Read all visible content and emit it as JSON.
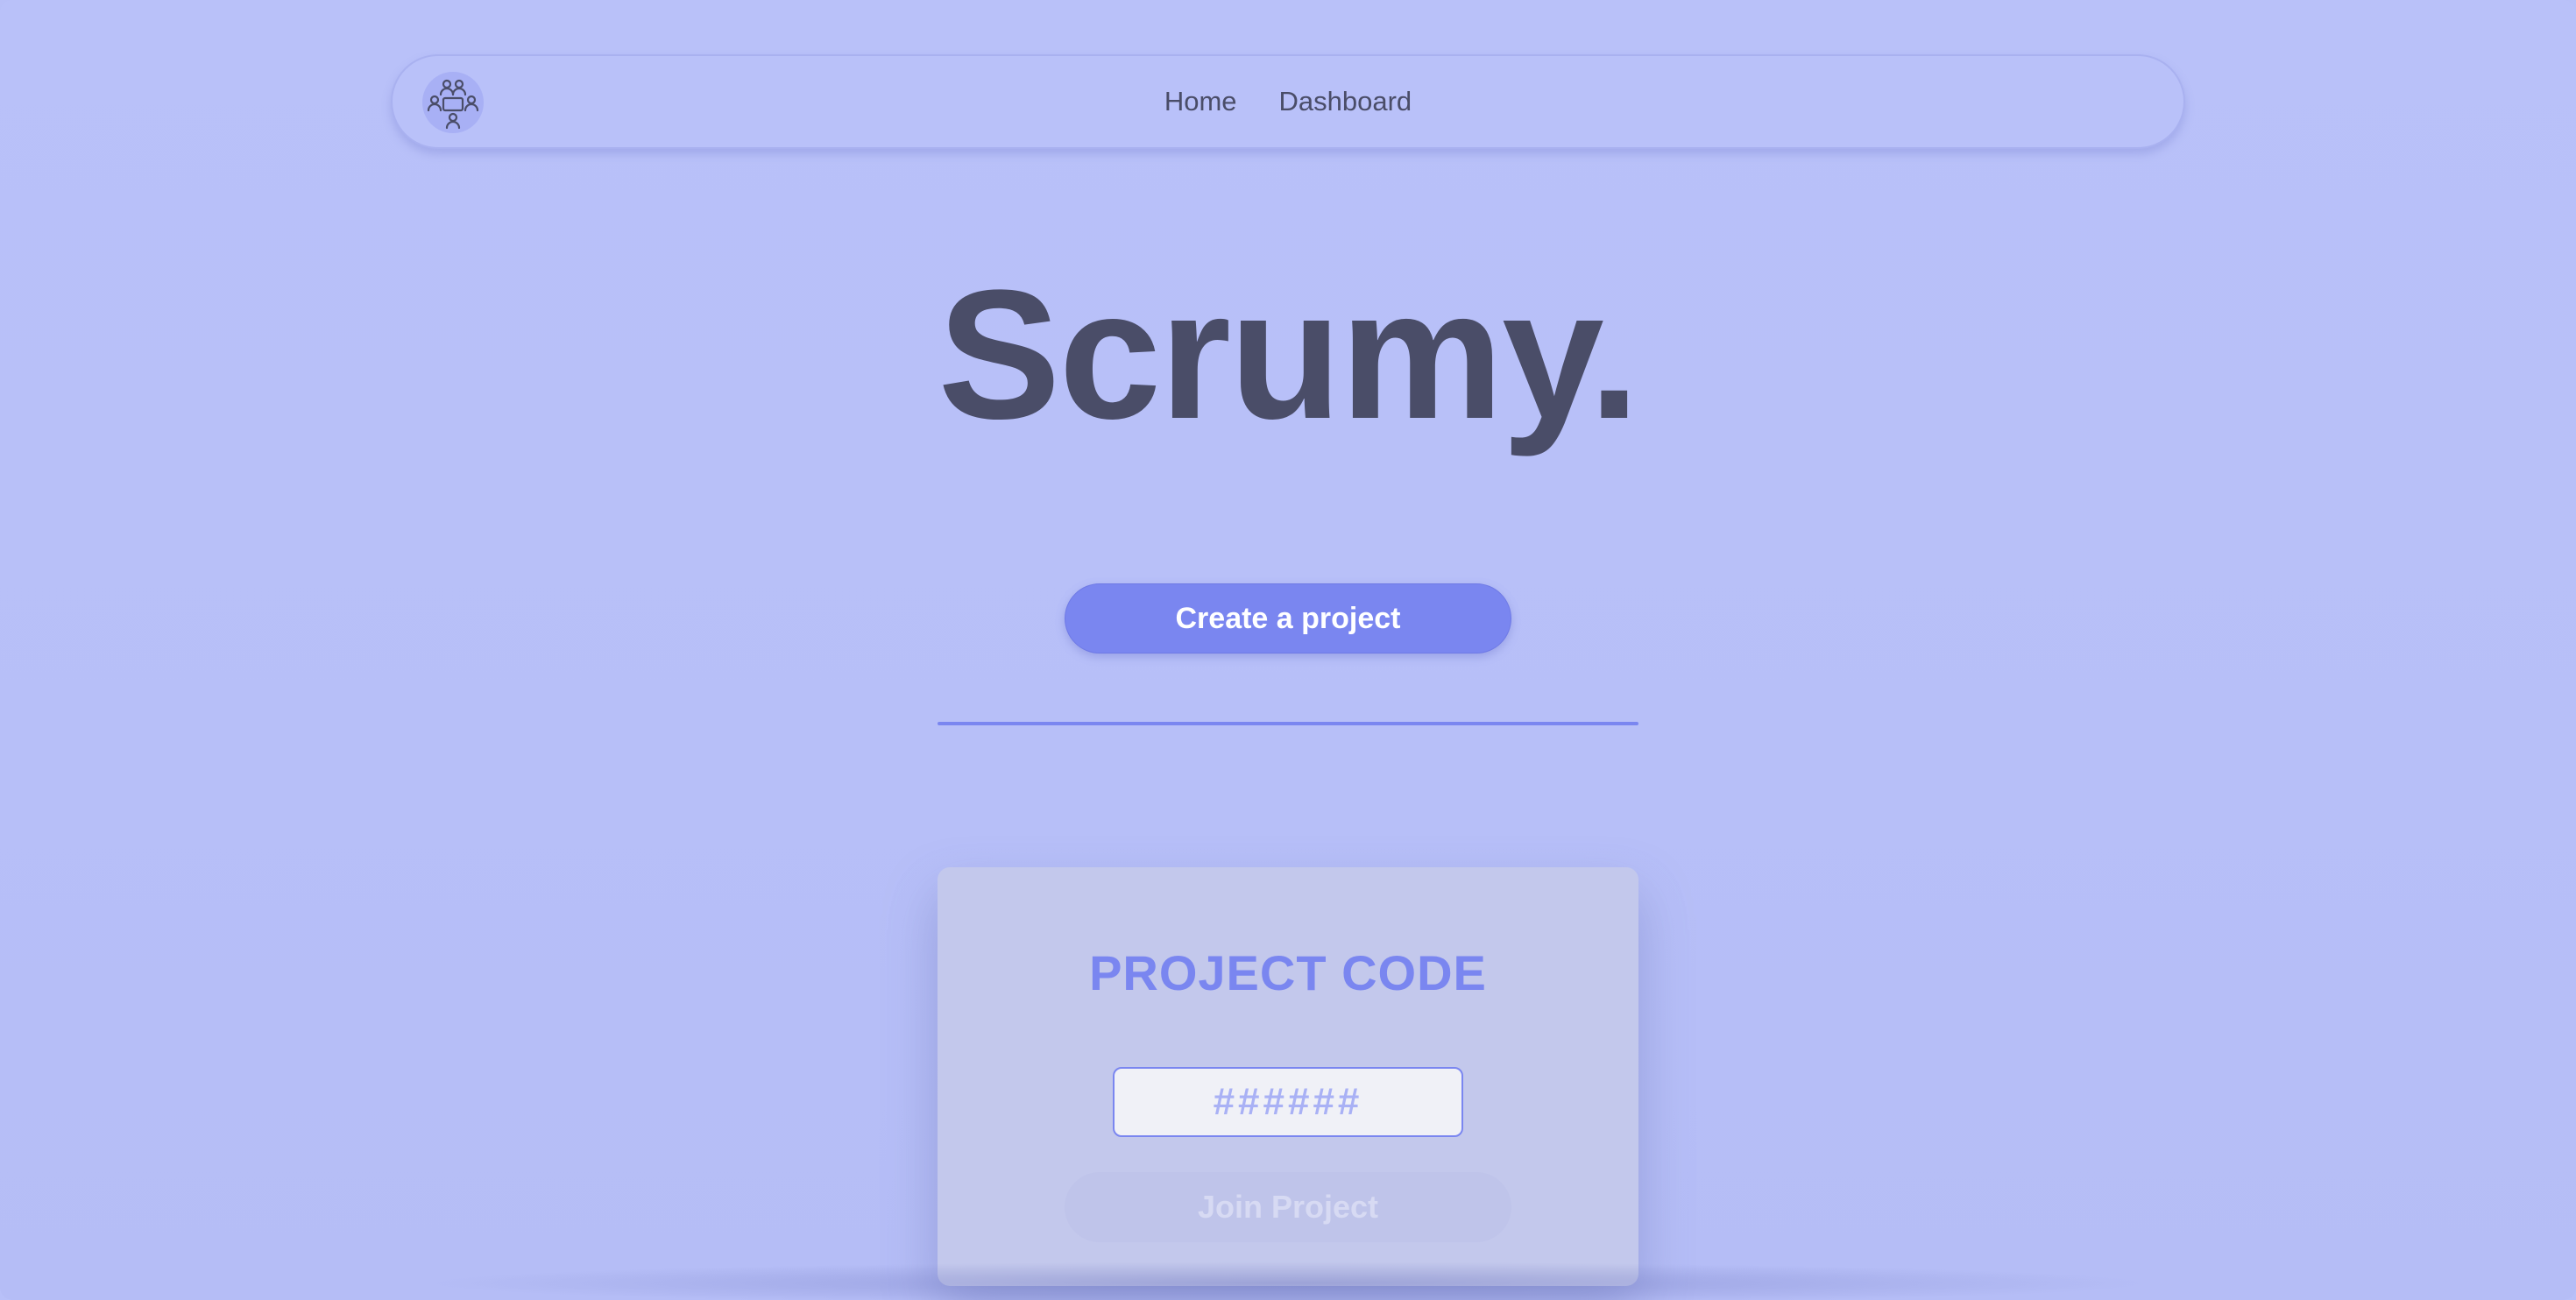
{
  "nav": {
    "logo_icon": "team-meeting-icon",
    "links": [
      {
        "label": "Home"
      },
      {
        "label": "Dashboard"
      }
    ]
  },
  "hero": {
    "title": "Scrumy."
  },
  "actions": {
    "create_label": "Create a project"
  },
  "join_card": {
    "title": "PROJECT CODE",
    "code_placeholder": "######",
    "join_label": "Join Project"
  },
  "colors": {
    "background": "#b8c0f8",
    "accent": "#7a86f0",
    "text_dark": "#4a4d68",
    "card": "#c3c8ec"
  }
}
